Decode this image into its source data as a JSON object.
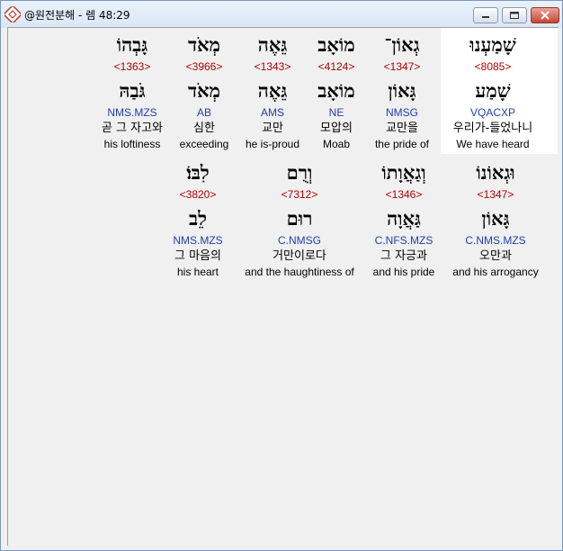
{
  "window": {
    "title": "@원전분해 - 렘 48:29"
  },
  "rows": [
    {
      "words": [
        {
          "heb": "גָּבְהוֹ",
          "strong": "<1363>",
          "lex": "גֹּבַהּ",
          "morph": "NMS.MZS",
          "ko": "곧 그 자고와",
          "en": "his loftiness"
        },
        {
          "heb": "מְאֹד",
          "strong": "<3966>",
          "lex": "מְאֹד",
          "morph": "AB",
          "ko": "심한",
          "en": "exceeding"
        },
        {
          "heb": "גֵּאֶה",
          "strong": "<1343>",
          "lex": "גֵּאֶה",
          "morph": "AMS",
          "ko": "교만",
          "en": "he is-proud"
        },
        {
          "heb": "מוֹאָב",
          "strong": "<4124>",
          "lex": "מוֹאָב",
          "morph": "NE",
          "ko": "모압의",
          "en": "Moab"
        },
        {
          "heb": "גְאוֹן־",
          "strong": "<1347>",
          "lex": "גָּאוֹן",
          "morph": "NMSG",
          "ko": "교만을",
          "en": "the pride of"
        },
        {
          "heb": "שָׁמַעְנוּ",
          "strong": "<8085>",
          "lex": "שָׁמַע",
          "morph": "VQACXP",
          "ko": "우리가-들었나니",
          "en": "We have heard"
        }
      ]
    },
    {
      "words": [
        {
          "heb": "לִבּוֹ׃",
          "strong": "<3820>",
          "lex": "לֵב",
          "morph": "NMS.MZS",
          "ko": "그 마음의",
          "en": "his heart"
        },
        {
          "heb": "וְרֻם",
          "strong": "<7312>",
          "lex": "רוּם",
          "morph": "C.NMSG",
          "ko": "거만이로다",
          "en": "and the haughtiness of"
        },
        {
          "heb": "וְגַאֲוָתוֹ",
          "strong": "<1346>",
          "lex": "גַּאֲוָה",
          "morph": "C.NFS.MZS",
          "ko": "그 자긍과",
          "en": "and his pride"
        },
        {
          "heb": "וּגְאוֹנוֹ",
          "strong": "<1347>",
          "lex": "גָּאוֹן",
          "morph": "C.NMS.MZS",
          "ko": "오만과",
          "en": "and his arrogancy"
        }
      ]
    }
  ]
}
